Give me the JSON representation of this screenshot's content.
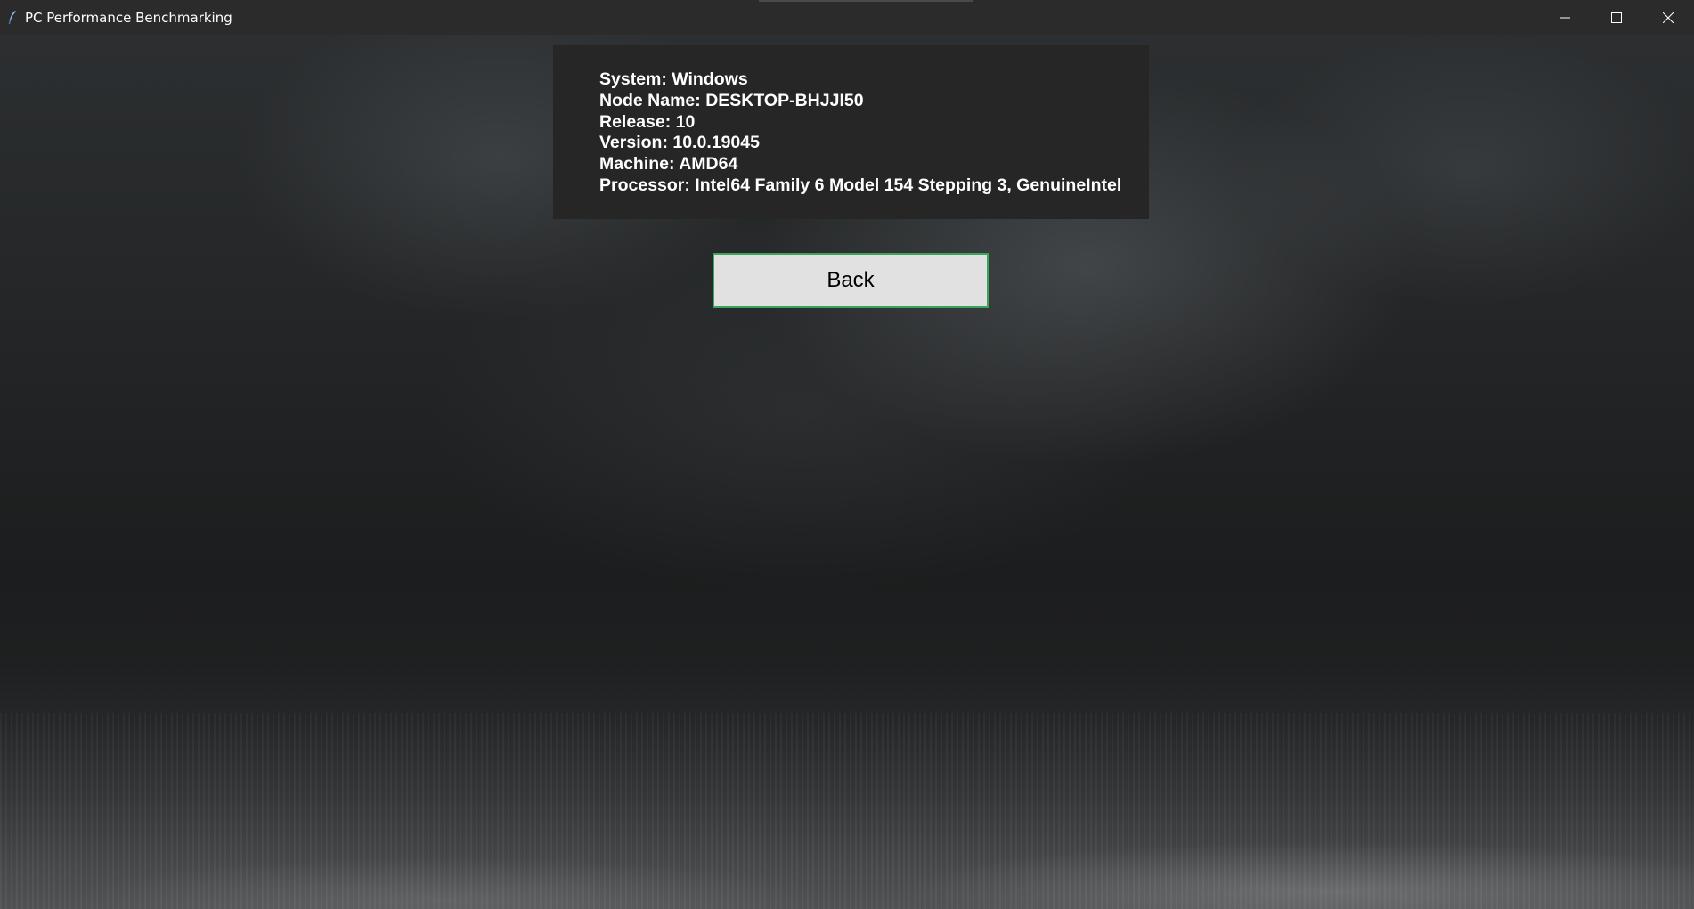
{
  "window": {
    "title": "PC Performance Benchmarking",
    "controls": {
      "minimize_icon": "minimize-icon",
      "maximize_icon": "maximize-icon",
      "close_icon": "close-icon"
    }
  },
  "system_info": {
    "lines": [
      "System: Windows",
      "Node Name: DESKTOP-BHJJI50",
      "Release: 10",
      "Version: 10.0.19045",
      "Machine: AMD64",
      "Processor: Intel64 Family 6 Model 154 Stepping 3, GenuineIntel"
    ]
  },
  "back_button": {
    "label": "Back"
  },
  "colors": {
    "titlebar": "#2b2b2b",
    "panel": "#262626",
    "button_bg": "#e1e1e1",
    "button_border": "#3aa55a"
  }
}
